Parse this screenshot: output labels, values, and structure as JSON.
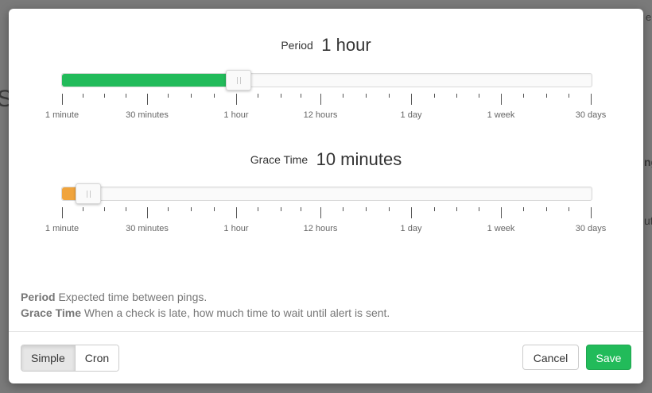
{
  "background": {
    "left_fragment": "S",
    "right_fragment_1": "ng",
    "right_fragment_2": "ut",
    "top_right_fragment": "e"
  },
  "modal": {
    "period": {
      "label": "Period",
      "value": "1 hour",
      "fill_color": "#22bb5a",
      "level_fraction": 0.333
    },
    "grace": {
      "label": "Grace Time",
      "value": "10 minutes",
      "fill_color": "#f0a43d",
      "level_fraction": 0.05
    },
    "scale_labels": [
      "1 minute",
      "30 minutes",
      "1 hour",
      "12 hours",
      "1 day",
      "1 week",
      "30 days"
    ],
    "help": {
      "period_term": "Period",
      "period_text": "Expected time between pings.",
      "grace_term": "Grace Time",
      "grace_text": "When a check is late, how much time to wait until alert is sent."
    },
    "footer": {
      "mode_simple": "Simple",
      "mode_cron": "Cron",
      "cancel": "Cancel",
      "save": "Save"
    }
  }
}
